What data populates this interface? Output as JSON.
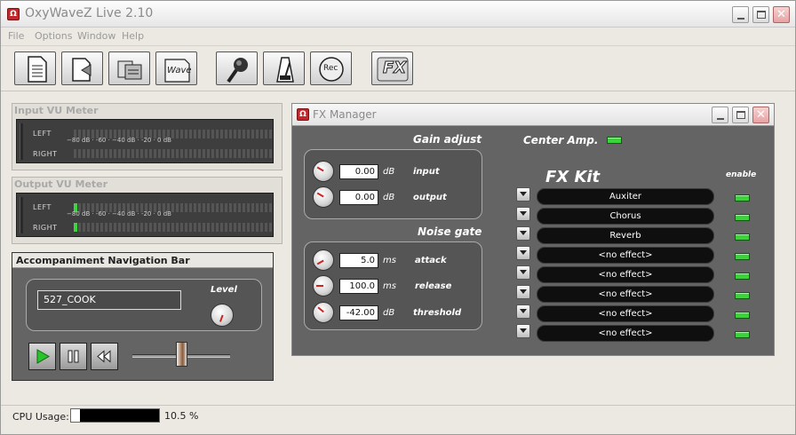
{
  "app": {
    "title": "OxyWaveZ Live 2.10"
  },
  "menu": [
    "File",
    "Options",
    "Window",
    "Help"
  ],
  "toolbar": {
    "wave_label": "Wave",
    "rec_label": "Rec",
    "fx_label": "FX"
  },
  "input_vu": {
    "title": "Input VU Meter",
    "left": "LEFT",
    "right": "RIGHT",
    "scale": "−80 dB · -60 · −40 dB · -20 · 0 dB"
  },
  "output_vu": {
    "title": "Output VU Meter",
    "left": "LEFT",
    "right": "RIGHT",
    "scale": "−80 dB · -60 · −40 dB · -20 · 0 dB"
  },
  "nav": {
    "title": "Accompaniment Navigation Bar",
    "track": "527_COOK",
    "level_label": "Level",
    "slider_position": 0.5
  },
  "fx": {
    "title": "FX Manager",
    "gain": {
      "header": "Gain adjust",
      "input_value": "0.00",
      "input_unit": "dB",
      "input_label": "input",
      "output_value": "0.00",
      "output_unit": "dB",
      "output_label": "output"
    },
    "center_amp": "Center Amp.",
    "noise": {
      "header": "Noise gate",
      "attack_value": "5.0",
      "attack_unit": "ms",
      "attack_label": "attack",
      "release_value": "100.0",
      "release_unit": "ms",
      "release_label": "release",
      "threshold_value": "-42.00",
      "threshold_unit": "dB",
      "threshold_label": "threshold"
    },
    "kit_title": "FX Kit",
    "enable_label": "enable",
    "slots": [
      "Auxiter",
      "Chorus",
      "Reverb",
      "<no effect>",
      "<no effect>",
      "<no effect>",
      "<no effect>",
      "<no effect>"
    ],
    "led_color": "#3cd23c"
  },
  "status": {
    "cpu_label": "CPU Usage:",
    "cpu_value": "10.5 %",
    "cpu_fraction": 0.105
  }
}
